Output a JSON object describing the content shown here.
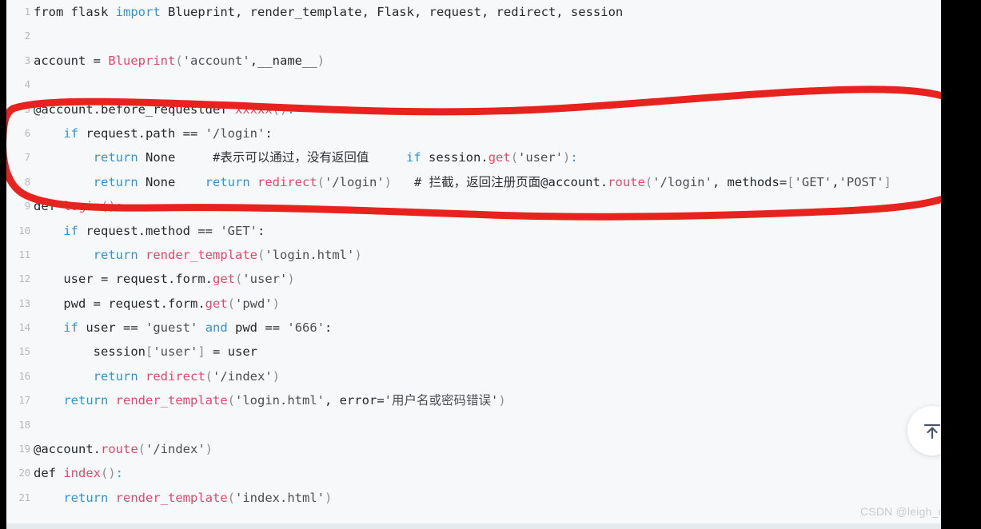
{
  "editor": {
    "language": "python",
    "background_color": "#f7f8f9",
    "gutter_color": "#b6b9bd",
    "lines": [
      {
        "number": "1",
        "tokens": [
          {
            "text": "from ",
            "type": "plain"
          },
          {
            "text": "flask ",
            "type": "plain"
          },
          {
            "text": "import",
            "type": "kw"
          },
          {
            "text": " Blueprint, render_template, Flask, request, redirect, session",
            "type": "plain"
          }
        ]
      },
      {
        "number": "2",
        "tokens": []
      },
      {
        "number": "3",
        "tokens": [
          {
            "text": "account ",
            "type": "plain"
          },
          {
            "text": "=",
            "type": "op"
          },
          {
            "text": " ",
            "type": "plain"
          },
          {
            "text": "Blueprint",
            "type": "fn"
          },
          {
            "text": "(",
            "type": "punc"
          },
          {
            "text": "'account'",
            "type": "str"
          },
          {
            "text": ",__name__",
            "type": "plain"
          },
          {
            "text": ")",
            "type": "punc"
          }
        ]
      },
      {
        "number": "4",
        "tokens": []
      },
      {
        "number": "5",
        "tokens": [
          {
            "text": "@account.before_requestdef ",
            "type": "plain"
          },
          {
            "text": "xxxxx",
            "type": "fn"
          },
          {
            "text": "()",
            "type": "punc"
          },
          {
            "text": ":",
            "type": "kw"
          }
        ]
      },
      {
        "number": "6",
        "tokens": [
          {
            "text": "    ",
            "type": "plain"
          },
          {
            "text": "if",
            "type": "kw"
          },
          {
            "text": " request.path ",
            "type": "plain"
          },
          {
            "text": "==",
            "type": "op"
          },
          {
            "text": " ",
            "type": "plain"
          },
          {
            "text": "'/login'",
            "type": "str"
          },
          {
            "text": ":",
            "type": "plain"
          }
        ]
      },
      {
        "number": "7",
        "tokens": [
          {
            "text": "        ",
            "type": "plain"
          },
          {
            "text": "return",
            "type": "kw"
          },
          {
            "text": " None",
            "type": "plain"
          },
          {
            "text": "     ",
            "type": "plain"
          },
          {
            "text": "#表示可以通过，没有返回值",
            "type": "com"
          },
          {
            "text": "     ",
            "type": "plain"
          },
          {
            "text": "if",
            "type": "kw"
          },
          {
            "text": " session.",
            "type": "plain"
          },
          {
            "text": "get",
            "type": "fn"
          },
          {
            "text": "(",
            "type": "punc"
          },
          {
            "text": "'user'",
            "type": "str"
          },
          {
            "text": ")",
            "type": "punc"
          },
          {
            "text": ":",
            "type": "kw"
          }
        ]
      },
      {
        "number": "8",
        "tokens": [
          {
            "text": "        ",
            "type": "plain"
          },
          {
            "text": "return",
            "type": "kw"
          },
          {
            "text": " None",
            "type": "plain"
          },
          {
            "text": "    ",
            "type": "plain"
          },
          {
            "text": "return",
            "type": "kw"
          },
          {
            "text": " ",
            "type": "plain"
          },
          {
            "text": "redirect",
            "type": "fn"
          },
          {
            "text": "(",
            "type": "punc"
          },
          {
            "text": "'/login'",
            "type": "str"
          },
          {
            "text": ")",
            "type": "punc"
          },
          {
            "text": "   ",
            "type": "plain"
          },
          {
            "text": "# 拦截，返回注册页面",
            "type": "com"
          },
          {
            "text": "@account.",
            "type": "plain"
          },
          {
            "text": "route",
            "type": "fn"
          },
          {
            "text": "(",
            "type": "punc"
          },
          {
            "text": "'/login'",
            "type": "str"
          },
          {
            "text": ", methods",
            "type": "plain"
          },
          {
            "text": "=",
            "type": "op"
          },
          {
            "text": "[",
            "type": "punc"
          },
          {
            "text": "'GET'",
            "type": "str"
          },
          {
            "text": ",",
            "type": "plain"
          },
          {
            "text": "'POST'",
            "type": "str"
          },
          {
            "text": "]",
            "type": "punc"
          }
        ]
      },
      {
        "number": "9",
        "tokens": [
          {
            "text": "def ",
            "type": "plain"
          },
          {
            "text": "login",
            "type": "fn"
          },
          {
            "text": "()",
            "type": "punc"
          },
          {
            "text": ":",
            "type": "kw"
          }
        ]
      },
      {
        "number": "10",
        "tokens": [
          {
            "text": "    ",
            "type": "plain"
          },
          {
            "text": "if",
            "type": "kw"
          },
          {
            "text": " request.method ",
            "type": "plain"
          },
          {
            "text": "==",
            "type": "op"
          },
          {
            "text": " ",
            "type": "plain"
          },
          {
            "text": "'GET'",
            "type": "str"
          },
          {
            "text": ":",
            "type": "plain"
          }
        ]
      },
      {
        "number": "11",
        "tokens": [
          {
            "text": "        ",
            "type": "plain"
          },
          {
            "text": "return",
            "type": "kw"
          },
          {
            "text": " ",
            "type": "plain"
          },
          {
            "text": "render_template",
            "type": "fn"
          },
          {
            "text": "(",
            "type": "punc"
          },
          {
            "text": "'login.html'",
            "type": "str"
          },
          {
            "text": ")",
            "type": "punc"
          }
        ]
      },
      {
        "number": "12",
        "tokens": [
          {
            "text": "    user ",
            "type": "plain"
          },
          {
            "text": "=",
            "type": "op"
          },
          {
            "text": " request.form.",
            "type": "plain"
          },
          {
            "text": "get",
            "type": "fn"
          },
          {
            "text": "(",
            "type": "punc"
          },
          {
            "text": "'user'",
            "type": "str"
          },
          {
            "text": ")",
            "type": "punc"
          }
        ]
      },
      {
        "number": "13",
        "tokens": [
          {
            "text": "    pwd ",
            "type": "plain"
          },
          {
            "text": "=",
            "type": "op"
          },
          {
            "text": " request.form.",
            "type": "plain"
          },
          {
            "text": "get",
            "type": "fn"
          },
          {
            "text": "(",
            "type": "punc"
          },
          {
            "text": "'pwd'",
            "type": "str"
          },
          {
            "text": ")",
            "type": "punc"
          }
        ]
      },
      {
        "number": "14",
        "tokens": [
          {
            "text": "    ",
            "type": "plain"
          },
          {
            "text": "if",
            "type": "kw"
          },
          {
            "text": " user ",
            "type": "plain"
          },
          {
            "text": "==",
            "type": "op"
          },
          {
            "text": " ",
            "type": "plain"
          },
          {
            "text": "'guest'",
            "type": "str"
          },
          {
            "text": " ",
            "type": "plain"
          },
          {
            "text": "and",
            "type": "kw"
          },
          {
            "text": " pwd ",
            "type": "plain"
          },
          {
            "text": "==",
            "type": "op"
          },
          {
            "text": " ",
            "type": "plain"
          },
          {
            "text": "'666'",
            "type": "str"
          },
          {
            "text": ":",
            "type": "plain"
          }
        ]
      },
      {
        "number": "15",
        "tokens": [
          {
            "text": "        session",
            "type": "plain"
          },
          {
            "text": "[",
            "type": "punc"
          },
          {
            "text": "'user'",
            "type": "str"
          },
          {
            "text": "]",
            "type": "punc"
          },
          {
            "text": " ",
            "type": "plain"
          },
          {
            "text": "=",
            "type": "op"
          },
          {
            "text": " user",
            "type": "plain"
          }
        ]
      },
      {
        "number": "16",
        "tokens": [
          {
            "text": "        ",
            "type": "plain"
          },
          {
            "text": "return",
            "type": "kw"
          },
          {
            "text": " ",
            "type": "plain"
          },
          {
            "text": "redirect",
            "type": "fn"
          },
          {
            "text": "(",
            "type": "punc"
          },
          {
            "text": "'/index'",
            "type": "str"
          },
          {
            "text": ")",
            "type": "punc"
          }
        ]
      },
      {
        "number": "17",
        "tokens": [
          {
            "text": "    ",
            "type": "plain"
          },
          {
            "text": "return",
            "type": "kw"
          },
          {
            "text": " ",
            "type": "plain"
          },
          {
            "text": "render_template",
            "type": "fn"
          },
          {
            "text": "(",
            "type": "punc"
          },
          {
            "text": "'login.html'",
            "type": "str"
          },
          {
            "text": ", error",
            "type": "plain"
          },
          {
            "text": "=",
            "type": "op"
          },
          {
            "text": "'用户名或密码错误'",
            "type": "str"
          },
          {
            "text": ")",
            "type": "punc"
          }
        ]
      },
      {
        "number": "18",
        "tokens": []
      },
      {
        "number": "19",
        "tokens": [
          {
            "text": "@account.",
            "type": "plain"
          },
          {
            "text": "route",
            "type": "fn"
          },
          {
            "text": "(",
            "type": "punc"
          },
          {
            "text": "'/index'",
            "type": "str"
          },
          {
            "text": ")",
            "type": "punc"
          }
        ]
      },
      {
        "number": "20",
        "tokens": [
          {
            "text": "def ",
            "type": "plain"
          },
          {
            "text": "index",
            "type": "fn"
          },
          {
            "text": "()",
            "type": "punc"
          },
          {
            "text": ":",
            "type": "kw"
          }
        ]
      },
      {
        "number": "21",
        "tokens": [
          {
            "text": "    ",
            "type": "plain"
          },
          {
            "text": "return",
            "type": "kw"
          },
          {
            "text": " ",
            "type": "plain"
          },
          {
            "text": "render_template",
            "type": "fn"
          },
          {
            "text": "(",
            "type": "punc"
          },
          {
            "text": "'index.html'",
            "type": "str"
          },
          {
            "text": ")",
            "type": "punc"
          }
        ]
      }
    ]
  },
  "annotation": {
    "shape": "hand-drawn-oval",
    "color": "#e8231f",
    "stroke_width": 9,
    "covers_lines": [
      "5",
      "6",
      "7",
      "8"
    ]
  },
  "scroll_top_button": {
    "icon": "arrow-up-to-line-icon",
    "icon_color": "#4a5568",
    "background": "#ffffff"
  },
  "watermark": {
    "text": "CSDN @leigh_chen",
    "color": "#c9ccd0"
  }
}
